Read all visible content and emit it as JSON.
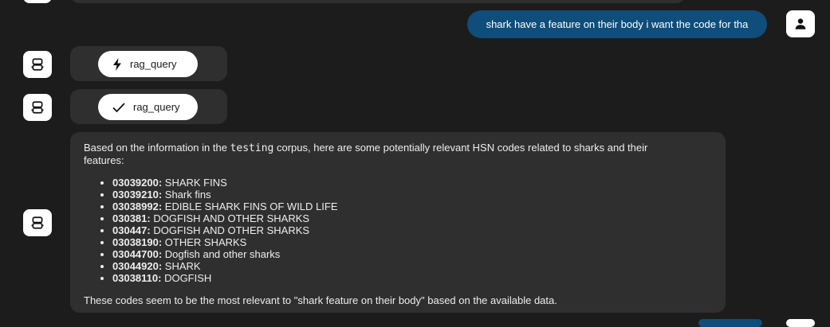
{
  "user_message": {
    "text": "shark have a feature on their body i want the code for tha",
    "avatar_icon": "person-icon"
  },
  "tool_calls": [
    {
      "label": "rag_query",
      "status_icon": "lightning-icon"
    },
    {
      "label": "rag_query",
      "status_icon": "checkmark-icon"
    }
  ],
  "assistant_message": {
    "intro_before": "Based on the information in the ",
    "corpus_name": "testing",
    "intro_after": " corpus, here are some potentially relevant HSN codes related to sharks and their features:",
    "items": [
      {
        "code": "03039200:",
        "desc": " SHARK FINS"
      },
      {
        "code": "03039210:",
        "desc": " Shark fins"
      },
      {
        "code": "03038992:",
        "desc": " EDIBLE SHARK FINS OF WILD LIFE"
      },
      {
        "code": "030381:",
        "desc": " DOGFISH AND OTHER SHARKS"
      },
      {
        "code": "030447:",
        "desc": " DOGFISH AND OTHER SHARKS"
      },
      {
        "code": "03038190:",
        "desc": " OTHER SHARKS"
      },
      {
        "code": "03044700:",
        "desc": " Dogfish and other sharks"
      },
      {
        "code": "03044920:",
        "desc": " SHARK"
      },
      {
        "code": "03038110:",
        "desc": " DOGFISH"
      }
    ],
    "closing": "These codes seem to be the most relevant to \"shark feature on their body\" based on the available data.",
    "avatar_icon": "robot-icon"
  },
  "colors": {
    "background": "#1c1c1c",
    "assistant_bubble": "#2f2f2f",
    "user_bubble": "#0f4d7a"
  }
}
